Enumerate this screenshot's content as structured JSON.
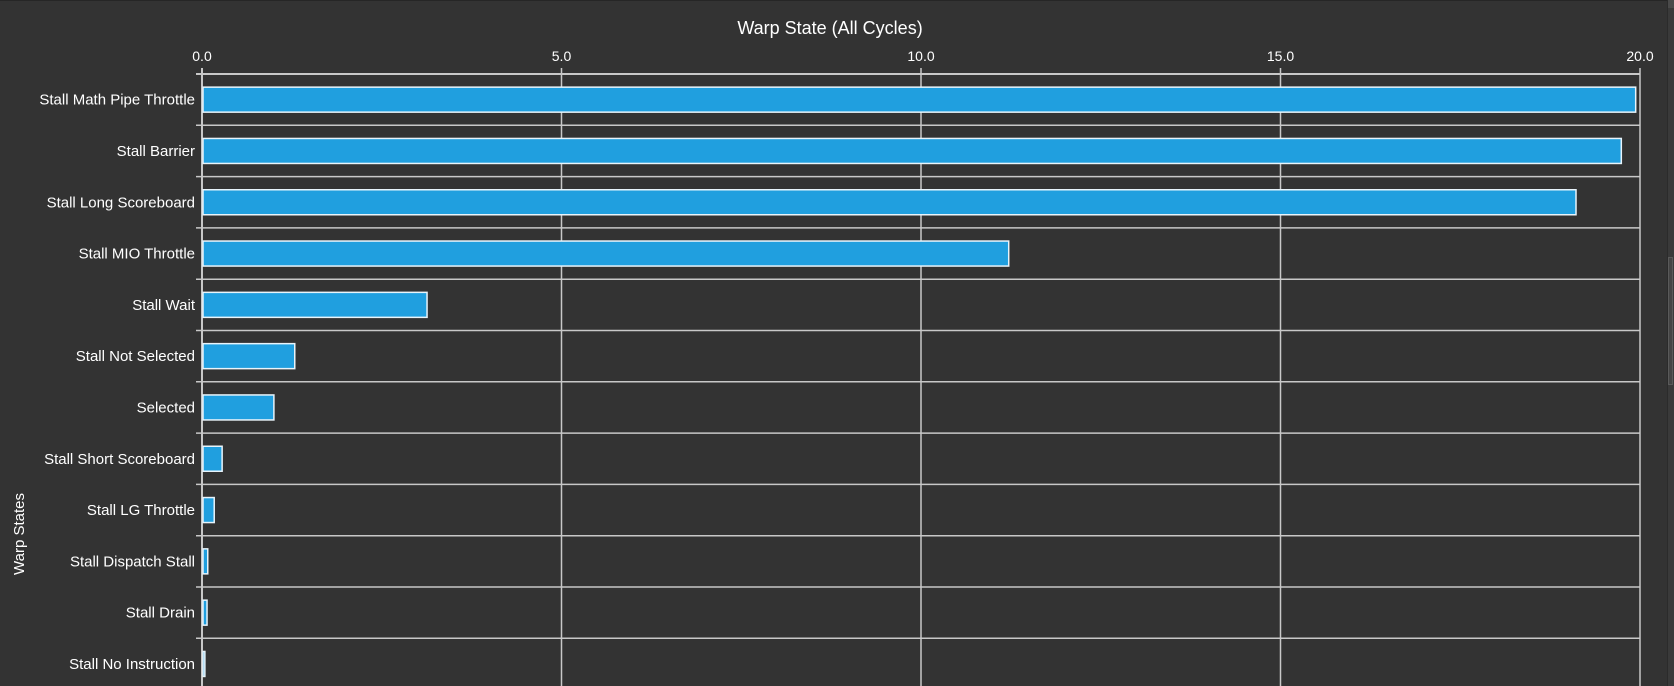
{
  "chart_data": {
    "type": "bar",
    "orientation": "horizontal",
    "title": "Warp State (All Cycles)",
    "xlabel": "",
    "ylabel": "Warp States",
    "xlim": [
      0,
      20
    ],
    "xticks": [
      "0.0",
      "5.0",
      "10.0",
      "15.0",
      "20.0"
    ],
    "xtick_values": [
      0,
      5,
      10,
      15,
      20
    ],
    "x_axis_position": "top",
    "grid": true,
    "categories": [
      "Stall Math Pipe Throttle",
      "Stall Barrier",
      "Stall Long Scoreboard",
      "Stall MIO Throttle",
      "Stall Wait",
      "Stall Not Selected",
      "Selected",
      "Stall Short Scoreboard",
      "Stall LG Throttle",
      "Stall Dispatch Stall",
      "Stall Drain",
      "Stall No Instruction"
    ],
    "values": [
      19.94,
      19.74,
      19.11,
      11.22,
      3.13,
      1.29,
      1.0,
      0.28,
      0.17,
      0.08,
      0.07,
      0.04
    ],
    "colors": {
      "bar_fill": "#209fdf",
      "bar_stroke": "#e8f4fb",
      "background": "#333333",
      "grid": "#c8c8c8",
      "text": "#ffffff"
    }
  }
}
